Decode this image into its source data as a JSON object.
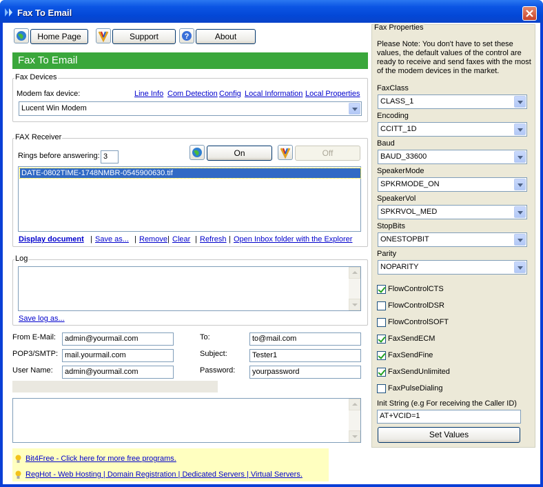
{
  "window": {
    "title": "Fax To Email"
  },
  "toolbar": {
    "home_label": "Home Page",
    "support_label": "Support",
    "about_label": "About"
  },
  "banner": {
    "text": "Fax To Email"
  },
  "fax_devices": {
    "group_title": "Fax Devices",
    "modem_label": "Modem fax device:",
    "links": [
      "Line Info",
      "Com Detection",
      "Config",
      "Local Information",
      "Local Properties"
    ],
    "selected_device": "Lucent Win Modem"
  },
  "fax_receiver": {
    "group_title": "FAX Receiver",
    "rings_label": "Rings before answering:",
    "rings_value": "3",
    "on_label": "On",
    "off_label": "Off",
    "files": [
      "DATE-0802TIME-1748NMBR-0545900630.tif"
    ],
    "actions": {
      "display": "Display document",
      "save_as": "Save as...",
      "remove": "Remove",
      "clear": "Clear",
      "refresh": "Refresh",
      "open_inbox": "Open Inbox folder with the Explorer"
    }
  },
  "log": {
    "group_title": "Log",
    "save_link": "Save log as..."
  },
  "email_form": {
    "from_label": "From E-Mail:",
    "from_value": "admin@yourmail.com",
    "pop_label": "POP3/SMTP:",
    "pop_value": "mail.yourmail.com",
    "user_label": "User Name:",
    "user_value": "admin@yourmail.com",
    "to_label": "To:",
    "to_value": "to@mail.com",
    "subject_label": "Subject:",
    "subject_value": "Tester1",
    "password_label": "Password:",
    "password_value": "yourpassword"
  },
  "footer_links": {
    "bit4free": "Bit4Free - Click here for more free programs.",
    "reghot": "RegHot - Web Hosting | Domain Registration | Dedicated Servers | Virtual Servers."
  },
  "fax_properties": {
    "title": "Fax Properties",
    "note": "Please Note: You don't have to set these values, the default values of the control are ready to receive and send faxes with the most of the modem devices in the market.",
    "fields": [
      {
        "label": "FaxClass",
        "value": "CLASS_1"
      },
      {
        "label": "Encoding",
        "value": "CCITT_1D"
      },
      {
        "label": "Baud",
        "value": "BAUD_33600"
      },
      {
        "label": "SpeakerMode",
        "value": "SPKRMODE_ON"
      },
      {
        "label": "SpeakerVol",
        "value": "SPKRVOL_MED"
      },
      {
        "label": "StopBits",
        "value": "ONESTOPBIT"
      },
      {
        "label": "Parity",
        "value": "NOPARITY"
      }
    ],
    "checkboxes": [
      {
        "label": "FlowControlCTS",
        "checked": true
      },
      {
        "label": "FlowControlDSR",
        "checked": false
      },
      {
        "label": "FlowControlSOFT",
        "checked": false
      },
      {
        "label": "FaxSendECM",
        "checked": true
      },
      {
        "label": "FaxSendFine",
        "checked": true
      },
      {
        "label": "FaxSendUnlimited",
        "checked": true
      },
      {
        "label": "FaxPulseDialing",
        "checked": false
      }
    ],
    "init_label": "Init String (e.g For receiving the Caller ID)",
    "init_value": "AT+VCID=1",
    "set_values_label": "Set Values"
  },
  "colors": {
    "banner": "#3aa73b",
    "titlebar": "#0347d6",
    "selection": "#316ac5",
    "link": "#0000cc",
    "infobar": "#ffffc0"
  }
}
